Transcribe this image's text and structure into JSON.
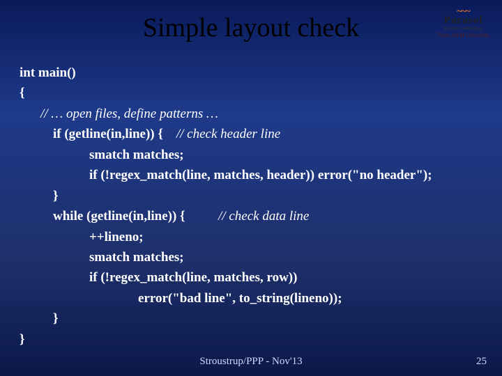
{
  "logo": {
    "arc": "~~~",
    "main": "Parasol",
    "sub": "Smarter computing.",
    "univ": "Texas A&M University"
  },
  "title": "Simple layout check",
  "code": {
    "l1": "int main()",
    "l2": "{",
    "l3a": "// … open files, define patterns …",
    "l4a": "if (getline(in,line)) {",
    "l4b": "// check header line",
    "l5": "smatch matches;",
    "l6": "if (!regex_match(line, matches, header)) error(\"no header\");",
    "l7": "}",
    "l8a": "while (getline(in,line)) {",
    "l8b": "// check data line",
    "l9": "++lineno;",
    "l10": "smatch matches;",
    "l11": "if (!regex_match(line, matches, row))",
    "l12": "error(\"bad line\", to_string(lineno));",
    "l13": "}",
    "l14": "}"
  },
  "footer": {
    "center": "Stroustrup/PPP - Nov'13",
    "page": "25"
  }
}
